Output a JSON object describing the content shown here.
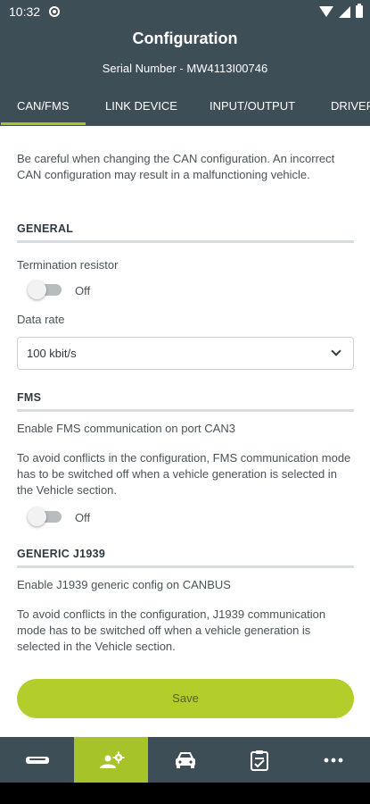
{
  "status_bar": {
    "time": "10:32"
  },
  "header": {
    "title": "Configuration",
    "serial": "Serial Number - MW4113I00746"
  },
  "tabs": [
    {
      "label": "CAN/FMS",
      "active": true
    },
    {
      "label": "LINK DEVICE",
      "active": false
    },
    {
      "label": "INPUT/OUTPUT",
      "active": false
    },
    {
      "label": "DRIVER",
      "active": false
    }
  ],
  "warning": "Be careful when changing the CAN configuration. An incorrect CAN configuration may result in a malfunctioning vehicle.",
  "general": {
    "heading": "GENERAL",
    "termination_label": "Termination resistor",
    "termination_state": "Off",
    "data_rate_label": "Data rate",
    "data_rate_value": "100 kbit/s"
  },
  "fms": {
    "heading": "FMS",
    "enable_label": "Enable FMS communication on port CAN3",
    "note": "To avoid conflicts in the configuration, FMS communication mode has to be switched off when a vehicle generation is selected in the Vehicle section.",
    "state": "Off"
  },
  "j1939": {
    "heading": "GENERIC J1939",
    "enable_label": "Enable J1939 generic config on CANBUS",
    "note": "To avoid conflicts in the configuration, J1939 communication mode has to be switched off when a vehicle generation is selected in the Vehicle section."
  },
  "save_label": "Save",
  "bottom_nav": [
    {
      "icon": "device-icon",
      "active": false
    },
    {
      "icon": "user-settings-icon",
      "active": true
    },
    {
      "icon": "car-icon",
      "active": false
    },
    {
      "icon": "checklist-icon",
      "active": false
    },
    {
      "icon": "more-icon",
      "active": false
    }
  ],
  "colors": {
    "header": "#3e4e56",
    "accent": "#a6c32a",
    "save_button": "#b3cd2b"
  }
}
